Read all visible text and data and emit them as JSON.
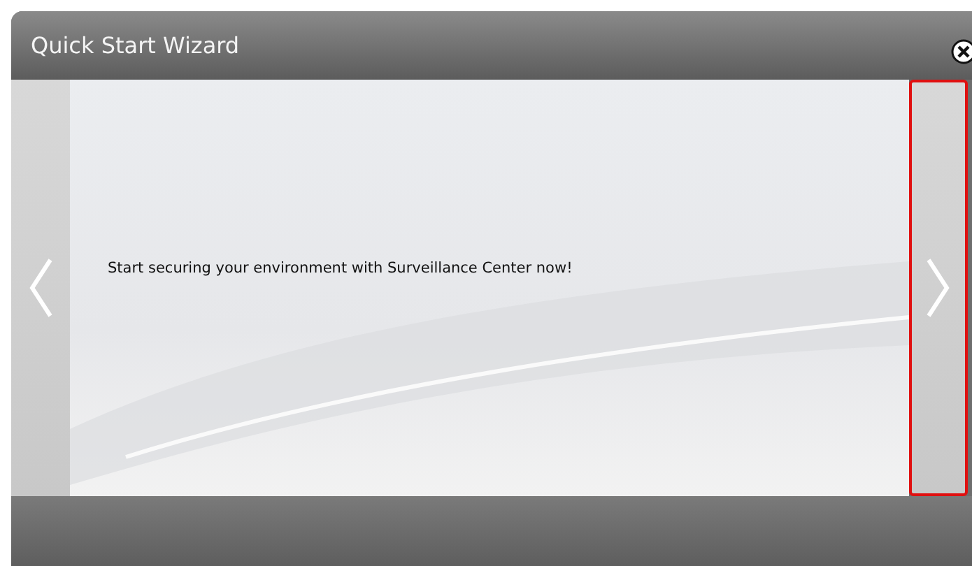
{
  "window": {
    "title": "Quick Start Wizard"
  },
  "prev_button": {
    "focused": false
  },
  "message": "Start securing your environment with Surveillance Center now!",
  "next_button": {
    "focused": true
  }
}
